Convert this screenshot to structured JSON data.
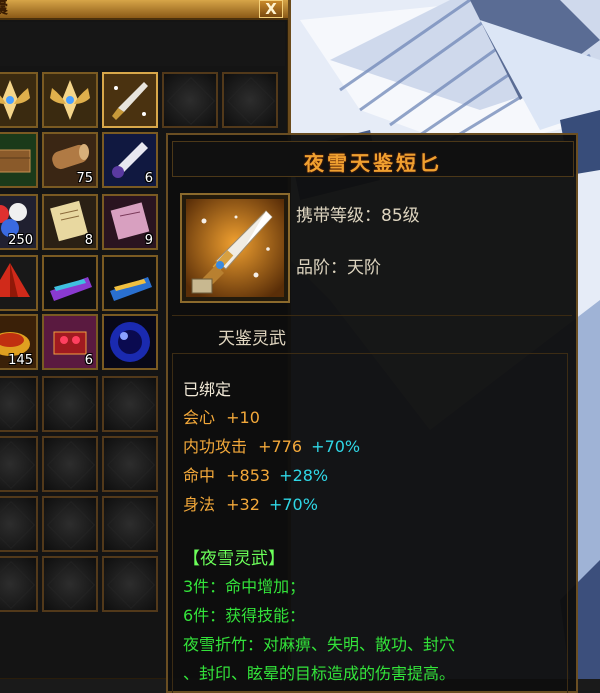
{
  "bag": {
    "title": "囊",
    "close_label": "X",
    "slots": [
      {
        "icon": "winged-relic-icon",
        "count": ""
      },
      {
        "icon": "winged-relic-icon",
        "count": ""
      },
      {
        "icon": "dagger-icon",
        "count": ""
      },
      {
        "icon": "",
        "count": ""
      },
      {
        "icon": "",
        "count": ""
      },
      {
        "icon": "wooden-box-icon",
        "count": ""
      },
      {
        "icon": "log-icon",
        "count": "75"
      },
      {
        "icon": "brush-icon",
        "count": "6"
      },
      {
        "icon": "potion-orbs-icon",
        "count": "250"
      },
      {
        "icon": "scroll-icon",
        "count": "8"
      },
      {
        "icon": "pink-scroll-icon",
        "count": "9"
      },
      {
        "icon": "red-tent-icon",
        "count": ""
      },
      {
        "icon": "purple-banner-icon",
        "count": ""
      },
      {
        "icon": "blue-banner-icon",
        "count": ""
      },
      {
        "icon": "gold-plate-icon",
        "count": "145"
      },
      {
        "icon": "ruby-chest-icon",
        "count": "6"
      },
      {
        "icon": "blue-orb-icon",
        "count": ""
      }
    ]
  },
  "tooltip": {
    "item_name": "夜雪天鉴短匕",
    "level": "携带等级：85级",
    "grade": "品阶：天阶",
    "item_type": "天鉴灵武",
    "bound": "已绑定",
    "stats": [
      {
        "name": "会心",
        "value": "+10",
        "bonus": ""
      },
      {
        "name": "内功攻击",
        "value": "+776",
        "bonus": "+70%"
      },
      {
        "name": "命中",
        "value": "+853",
        "bonus": "+28%"
      },
      {
        "name": "身法",
        "value": "+32",
        "bonus": "+70%"
      }
    ],
    "set_name": "【夜雪灵武】",
    "set_bonus_3": "3件：命中增加；",
    "set_bonus_6": "6件：获得技能：",
    "skill_line_1": "夜雪折竹：对麻痹、失明、散功、封穴",
    "skill_line_2": "、封印、眩晕的目标造成的伤害提高。"
  },
  "colors": {
    "frame_gold": "#7a5a22",
    "title_orange": "#f0a030",
    "stat_orange": "#f2a83a",
    "bonus_cyan": "#2fd7e6",
    "set_green": "#33e33a"
  }
}
